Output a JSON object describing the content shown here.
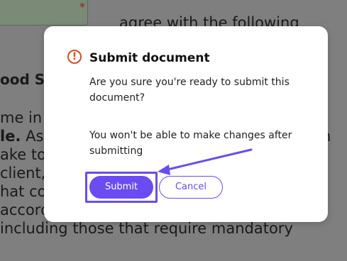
{
  "background_doc": {
    "line_top": "agree with the following",
    "heading": "ood S",
    "line1": "me in",
    "line2_bold": "le.",
    "line2_rest": " As",
    "line2_right": "h",
    "line3": "ake to",
    "line4": "client,",
    "line5": "hat co",
    "line6": "accord",
    "line7": "including those that require mandatory",
    "required_mark": "*"
  },
  "modal": {
    "title": "Submit document",
    "warning_glyph": "!",
    "message1": "Are you sure you're ready to submit this document?",
    "message2": "You won't be able to make changes after submitting",
    "submit_label": "Submit",
    "cancel_label": "Cancel"
  },
  "colors": {
    "accent": "#6a4cf2",
    "warning": "#d94e1f",
    "overlay": "#7f7f7f"
  },
  "icons": {
    "warning": "exclamation-circle-icon",
    "annotation": "arrow-annotation"
  }
}
